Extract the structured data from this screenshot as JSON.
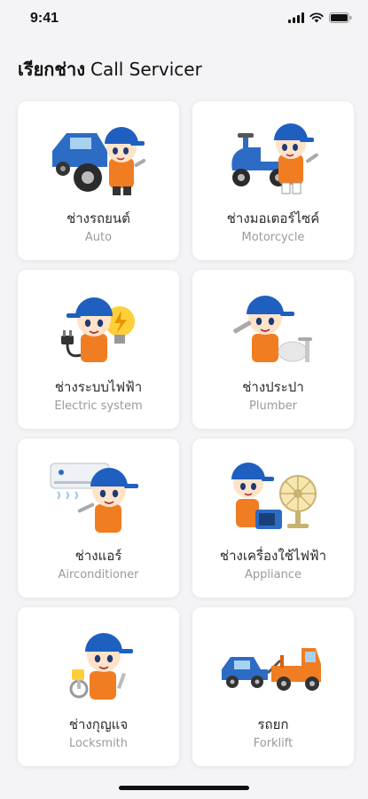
{
  "status_bar": {
    "time": "9:41"
  },
  "header": {
    "title_thai": "เรียกช่าง",
    "title_english": "Call Servicer"
  },
  "services": [
    {
      "thai": "ช่างรถยนต์",
      "english": "Auto",
      "icon": "car-mechanic-icon"
    },
    {
      "thai": "ช่างมอเตอร์ไซค์",
      "english": "Motorcycle",
      "icon": "motorcycle-mechanic-icon"
    },
    {
      "thai": "ช่างระบบไฟฟ้า",
      "english": "Electric system",
      "icon": "electrician-icon"
    },
    {
      "thai": "ช่างประปา",
      "english": "Plumber",
      "icon": "plumber-icon"
    },
    {
      "thai": "ช่างแอร์",
      "english": "Airconditioner",
      "icon": "aircon-technician-icon"
    },
    {
      "thai": "ช่างเครื่องใช้ไฟฟ้า",
      "english": "Appliance",
      "icon": "appliance-technician-icon"
    },
    {
      "thai": "ช่างกุญแจ",
      "english": "Locksmith",
      "icon": "locksmith-icon"
    },
    {
      "thai": "รถยก",
      "english": "Forklift",
      "icon": "tow-truck-icon"
    }
  ],
  "colors": {
    "mascot_cap": "#1f5fbf",
    "mascot_uniform": "#f07d22",
    "card_background": "#ffffff",
    "page_background": "#f4f4f6"
  }
}
